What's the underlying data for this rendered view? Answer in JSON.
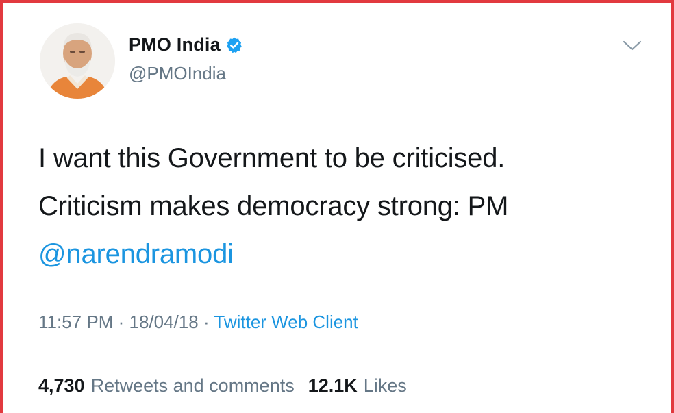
{
  "tweet": {
    "author": {
      "display_name": "PMO India",
      "handle": "@PMOIndia",
      "verified": true,
      "avatar_icon": "profile-photo"
    },
    "text_line_1": "I want this Government to be criticised.",
    "text_line_2": "Criticism makes democracy strong: PM",
    "mention": "@narendramodi",
    "time": "11:57 PM",
    "separator": "·",
    "date": "18/04/18",
    "source": "Twitter Web Client",
    "stats": {
      "retweets_count": "4,730",
      "retweets_label": "Retweets and comments",
      "likes_count": "12.1K",
      "likes_label": "Likes"
    }
  },
  "colors": {
    "frame_border": "#e2393f",
    "link": "#1b95e0",
    "secondary_text": "#657786",
    "verified_badge": "#1da1f2"
  }
}
